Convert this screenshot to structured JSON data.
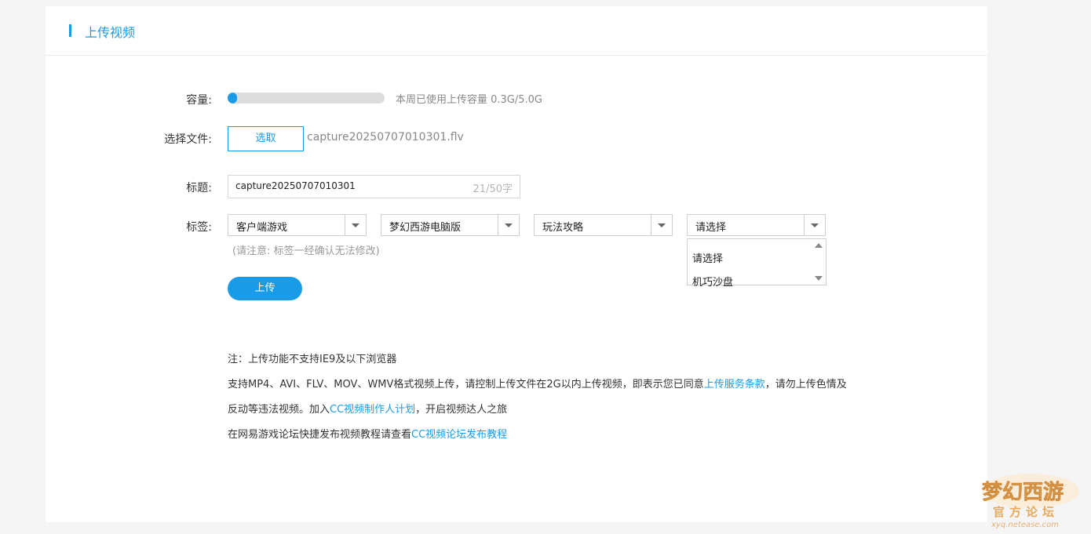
{
  "header": {
    "title": "上传视频"
  },
  "capacity": {
    "label": "容量:",
    "used_fraction": 0.06,
    "text": "本周已使用上传容量 0.3G/5.0G"
  },
  "file": {
    "label": "选择文件:",
    "choose_label": "选取",
    "filename": "capture20250707010301.flv"
  },
  "title_field": {
    "label": "标题:",
    "value": "capture20250707010301",
    "counter": "21/50字"
  },
  "tags": {
    "label": "标签:",
    "selects": [
      "客户端游戏",
      "梦幻西游电脑版",
      "玩法攻略",
      "请选择"
    ],
    "note": "(请注意: 标签一经确认无法修改)",
    "dropdown_options": [
      "请选择",
      "机巧沙盘"
    ]
  },
  "upload_label": "上传",
  "notes": {
    "line1": "注：上传功能不支持IE9及以下浏览器",
    "line2_before": "支持MP4、AVI、FLV、MOV、WMV格式视频上传，请控制上传文件在2G以内上传视频，即表示您已同意",
    "line2_link": "上传服务条款",
    "line2_after": "，请勿上传色情及",
    "line3_before": "反动等违法视频。加入",
    "line3_link": "CC视频制作人计划",
    "line3_after": "，开启视频达人之旅",
    "line4_before": "在网易游戏论坛快捷发布视频教程请查看",
    "line4_link": "CC视频论坛发布教程"
  },
  "watermark": {
    "name": "梦幻西游",
    "sub": "官方论坛",
    "url": "xyq.netease.com"
  },
  "colors": {
    "accent": "#1a9be8",
    "background": "#f5f5f5",
    "card": "#ffffff"
  }
}
